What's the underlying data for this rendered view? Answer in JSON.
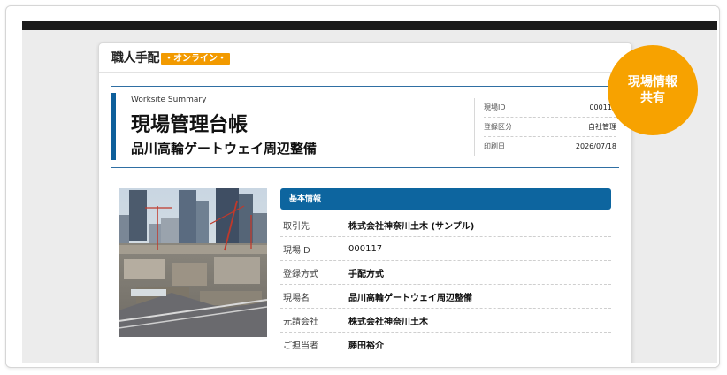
{
  "logo": {
    "main": "職人手配",
    "sub": "・オンライン・"
  },
  "summary": {
    "label": "Worksite Summary",
    "title": "現場管理台帳",
    "site_name": "品川高輪ゲートウェイ周辺整備"
  },
  "meta": [
    {
      "key": "現場ID",
      "value": "000117"
    },
    {
      "key": "登録区分",
      "value": "自社管理"
    },
    {
      "key": "印刷日",
      "value": "2026/07/18"
    }
  ],
  "photo": {
    "subject": "construction-site-cityscape"
  },
  "info": {
    "heading": "基本情報",
    "rows": [
      {
        "key": "取引先",
        "value": "株式会社神奈川土木 (サンプル)"
      },
      {
        "key": "現場ID",
        "value": "000117"
      },
      {
        "key": "登録方式",
        "value": "手配方式"
      },
      {
        "key": "現場名",
        "value": "品川高輪ゲートウェイ周辺整備"
      },
      {
        "key": "元請会社",
        "value": "株式会社神奈川土木"
      },
      {
        "key": "ご担当者",
        "value": "藤田裕介"
      }
    ]
  },
  "badge": {
    "line1": "現場情報",
    "line2": "共有"
  },
  "colors": {
    "accent_blue": "#0d659f",
    "badge_orange": "#f7a200",
    "topbar": "#1b1b1b"
  }
}
